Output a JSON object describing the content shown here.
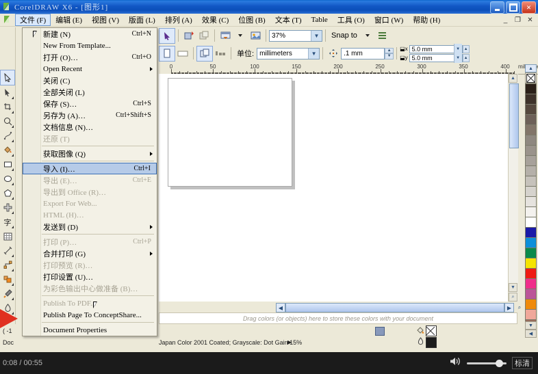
{
  "window": {
    "title": "CorelDRAW X6 - [图形1]",
    "buttons": {
      "minimize": "_",
      "maximize": "□",
      "close": "✕"
    },
    "doc_buttons": {
      "minimize": "_",
      "restore": "❐",
      "close": "✕"
    }
  },
  "menubar": {
    "items": [
      {
        "label": "文件 (F)",
        "active": true
      },
      {
        "label": "编辑 (E)",
        "active": false
      },
      {
        "label": "视图 (V)",
        "active": false
      },
      {
        "label": "版面 (L)",
        "active": false
      },
      {
        "label": "排列 (A)",
        "active": false
      },
      {
        "label": "效果 (C)",
        "active": false
      },
      {
        "label": "位图 (B)",
        "active": false
      },
      {
        "label": "文本 (T)",
        "active": false
      },
      {
        "label": "Table",
        "active": false
      },
      {
        "label": "工具 (O)",
        "active": false
      },
      {
        "label": "窗口 (W)",
        "active": false
      },
      {
        "label": "帮助 (H)",
        "active": false
      }
    ]
  },
  "file_menu": {
    "items": [
      {
        "label": "新建 (N)",
        "accel": "Ctrl+N",
        "disabled": false,
        "submenu": false,
        "highlight": false,
        "icon": "new-doc-icon"
      },
      {
        "label": "New From Template...",
        "accel": "",
        "disabled": false,
        "submenu": false,
        "highlight": false,
        "icon": "template-icon"
      },
      {
        "label": "打开 (O)…",
        "accel": "Ctrl+O",
        "disabled": false,
        "submenu": false,
        "highlight": false,
        "icon": "open-folder-icon"
      },
      {
        "label": "Open Recent",
        "accel": "",
        "disabled": false,
        "submenu": true,
        "highlight": false,
        "icon": ""
      },
      {
        "label": "关闭 (C)",
        "accel": "",
        "disabled": false,
        "submenu": false,
        "highlight": false,
        "icon": "close-doc-icon"
      },
      {
        "label": "全部关闭 (L)",
        "accel": "",
        "disabled": false,
        "submenu": false,
        "highlight": false,
        "icon": "close-all-icon"
      },
      {
        "label": "保存 (S)…",
        "accel": "Ctrl+S",
        "disabled": false,
        "submenu": false,
        "highlight": false,
        "icon": "save-icon"
      },
      {
        "label": "另存为 (A)…",
        "accel": "Ctrl+Shift+S",
        "disabled": false,
        "submenu": false,
        "highlight": false,
        "icon": "save-as-icon"
      },
      {
        "label": "文档信息 (N)…",
        "accel": "",
        "disabled": false,
        "submenu": false,
        "highlight": false,
        "icon": "doc-info-icon"
      },
      {
        "label": "还原 (T)",
        "accel": "",
        "disabled": true,
        "submenu": false,
        "highlight": false,
        "icon": "revert-icon"
      },
      {
        "separator": true
      },
      {
        "label": "获取图像 (Q)",
        "accel": "",
        "disabled": false,
        "submenu": true,
        "highlight": false,
        "icon": "acquire-image-icon"
      },
      {
        "separator": true
      },
      {
        "label": "导入 (I)…",
        "accel": "Ctrl+I",
        "disabled": false,
        "submenu": false,
        "highlight": true,
        "icon": "import-icon"
      },
      {
        "label": "导出 (E)…",
        "accel": "Ctrl+E",
        "disabled": true,
        "submenu": false,
        "highlight": false,
        "icon": "export-icon"
      },
      {
        "label": "导出到 Office (R)…",
        "accel": "",
        "disabled": true,
        "submenu": false,
        "highlight": false,
        "icon": "export-office-icon"
      },
      {
        "label": "Export For Web...",
        "accel": "",
        "disabled": true,
        "submenu": false,
        "highlight": false,
        "icon": "export-web-icon"
      },
      {
        "label": "HTML (H)…",
        "accel": "",
        "disabled": true,
        "submenu": false,
        "highlight": false,
        "icon": "html-icon"
      },
      {
        "label": "发送到 (D)",
        "accel": "",
        "disabled": false,
        "submenu": true,
        "highlight": false,
        "icon": ""
      },
      {
        "separator": true
      },
      {
        "label": "打印 (P)…",
        "accel": "Ctrl+P",
        "disabled": true,
        "submenu": false,
        "highlight": false,
        "icon": "print-icon"
      },
      {
        "label": "合并打印 (G)",
        "accel": "",
        "disabled": false,
        "submenu": true,
        "highlight": false,
        "icon": ""
      },
      {
        "label": "打印预览 (R)…",
        "accel": "",
        "disabled": true,
        "submenu": false,
        "highlight": false,
        "icon": "print-preview-icon"
      },
      {
        "label": "打印设置 (U)…",
        "accel": "",
        "disabled": false,
        "submenu": false,
        "highlight": false,
        "icon": "print-setup-icon"
      },
      {
        "label": "为彩色输出中心做准备 (B)…",
        "accel": "",
        "disabled": true,
        "submenu": false,
        "highlight": false,
        "icon": ""
      },
      {
        "separator": true
      },
      {
        "label": "Publish To PDF...",
        "accel": "",
        "disabled": true,
        "submenu": false,
        "highlight": false,
        "icon": "pdf-icon"
      },
      {
        "label": "Publish Page To ConceptShare...",
        "accel": "",
        "disabled": false,
        "submenu": false,
        "highlight": false,
        "icon": ""
      },
      {
        "separator": true
      },
      {
        "label": "Document Properties",
        "accel": "",
        "disabled": false,
        "submenu": false,
        "highlight": false,
        "icon": ""
      }
    ]
  },
  "toolbar_standard": {
    "zoom_value": "37%",
    "snap_to_label": "Snap to",
    "buttons": [
      "pick-tool-icon",
      "import-button-icon",
      "export-button-icon",
      "application-launcher-icon",
      "corel-connect-icon"
    ]
  },
  "toolbar_property": {
    "unit_label": "单位:",
    "unit_value": "millimeters",
    "nudge_value": ".1 mm",
    "duplicate_x": "5.0 mm",
    "duplicate_y": "5.0 mm"
  },
  "ruler": {
    "unit_label": "millimeters",
    "ticks": [
      0,
      50,
      100,
      150,
      200,
      250,
      300,
      350,
      400
    ]
  },
  "palette_hint": "Drag colors (or objects) here to store these colors with your document",
  "statusbar": {
    "color_profile": "Japan Color 2001 Coated; Grayscale: Dot Gain 15%",
    "coords": "( -1",
    "doc_label": "Doc",
    "fill_label": "fill-swatch",
    "outline_label": "outline-swatch"
  },
  "color_palette": {
    "no_color": "none-swatch",
    "swatches": [
      "#2b2018",
      "#3e322a",
      "#55483e",
      "#6d6058",
      "#827569",
      "#8f8880",
      "#9a938b",
      "#a7a19a",
      "#b5b0a9",
      "#c6c2bb",
      "#d6d3cd",
      "#e6e3de",
      "#f4f2ee",
      "#ffffff",
      "#1a1aa8",
      "#0d8fd9",
      "#0a8a4a",
      "#f5e400",
      "#ef1b12",
      "#ef2e8a",
      "#bb5598",
      "#ef8a0a",
      "#f0a89a",
      "#9a6b5a"
    ]
  },
  "video_player": {
    "current_time": "0:08",
    "separator": "/",
    "total_time": "00:55",
    "volume_icon": "speaker-icon",
    "quality": "标清"
  }
}
